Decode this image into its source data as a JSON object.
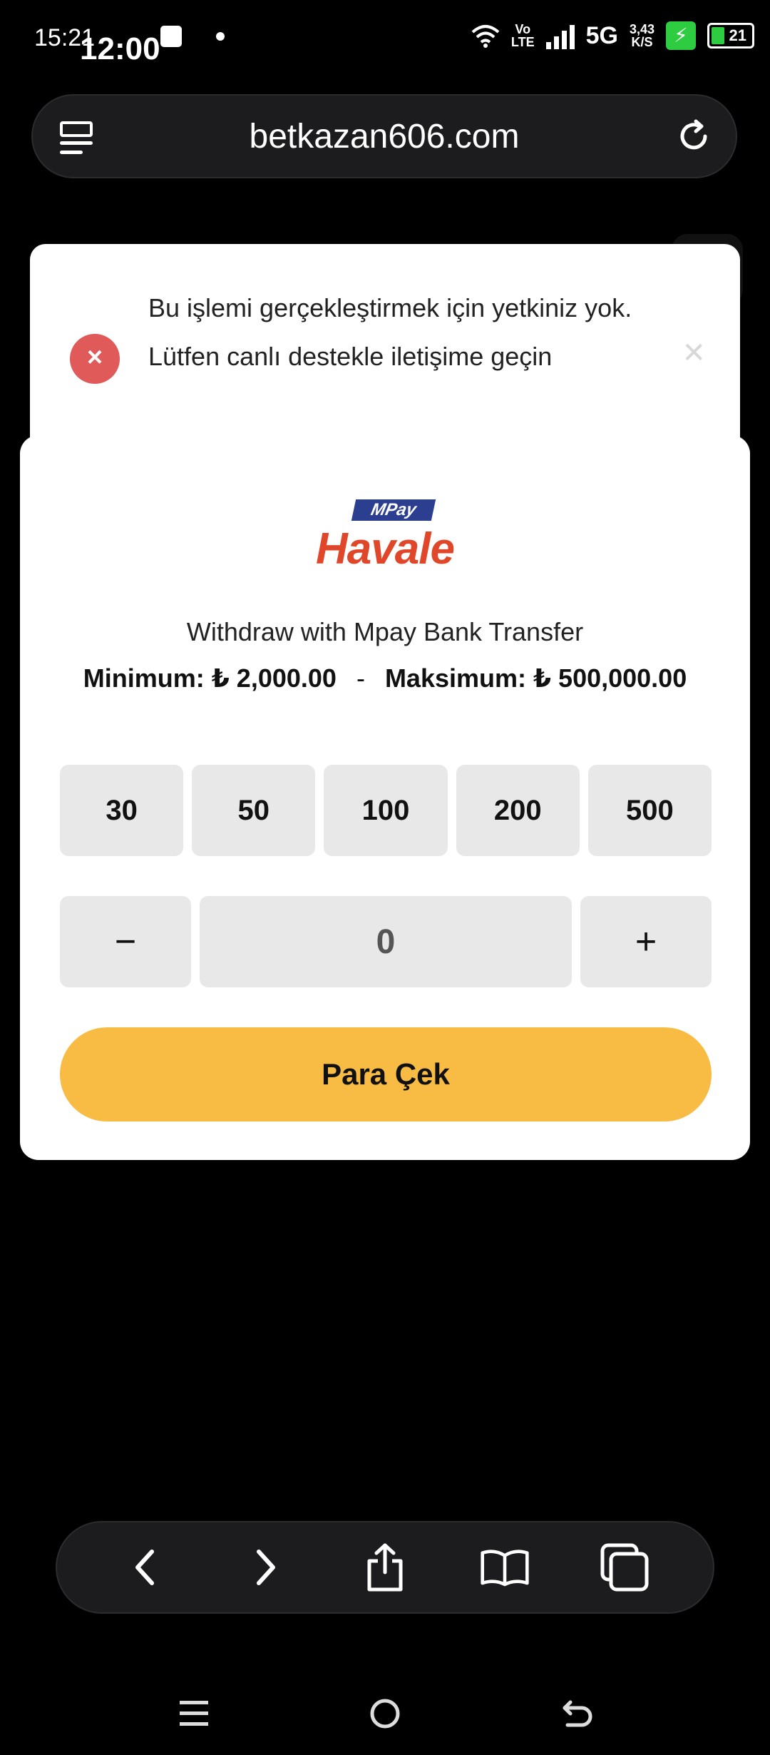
{
  "status_bar": {
    "time_small": "15:21",
    "time_large": "12:00",
    "network_label_top": "Vo",
    "network_label_bottom": "LTE",
    "network_type": "5G",
    "speed_value": "3,43",
    "speed_unit": "K/S",
    "battery_level": "21"
  },
  "browser": {
    "url": "betkazan606.com"
  },
  "toast": {
    "message": "Bu işlemi gerçekleştirmek için yetkiniz yok. Lütfen canlı destekle iletişime geçin",
    "error_icon_glyph": "×",
    "close_glyph": "✕"
  },
  "withdraw": {
    "logo_top": "MPay",
    "logo_main": "Havale",
    "title": "Withdraw with Mpay Bank Transfer",
    "minimum": "Minimum: ₺ 2,000.00",
    "separator": "-",
    "maximum": "Maksimum: ₺ 500,000.00",
    "quick_amounts": [
      "30",
      "50",
      "100",
      "200",
      "500"
    ],
    "decrement_glyph": "−",
    "amount": "0",
    "increment_glyph": "+",
    "submit_label": "Para Çek"
  },
  "colors": {
    "accent": "#f8bc45",
    "error": "#e05a5a",
    "logo_red": "#e0472a",
    "logo_blue": "#2c3e8f"
  }
}
